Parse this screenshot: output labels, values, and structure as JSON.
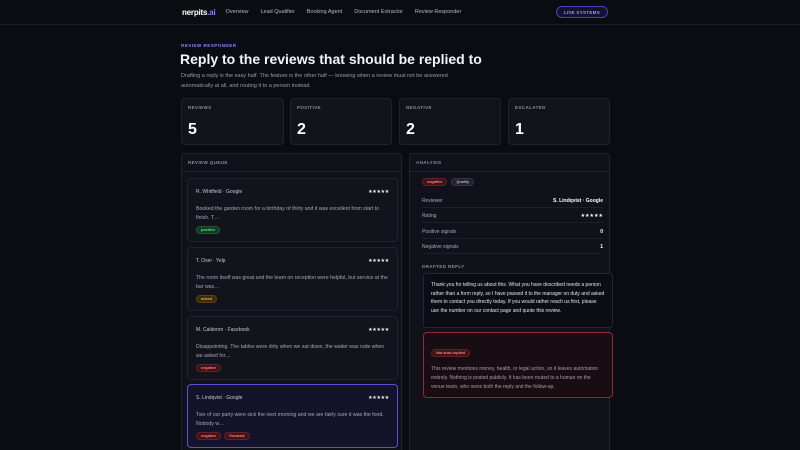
{
  "nav": {
    "brand": "nerpits",
    "brand_suffix": ".ai",
    "links": [
      "Overview",
      "Lead Qualifier",
      "Booking Agent",
      "Document Extractor",
      "Review Responder"
    ],
    "status_button": "LIVE SYSTEMS"
  },
  "header": {
    "eyebrow": "REVIEW RESPONDER",
    "title": "Reply to the reviews that should be replied to",
    "subtitle": "Drafting a reply is the easy half. The feature is the other half — knowing when a review must not be answered automatically at all, and routing it to a person instead."
  },
  "stats": [
    {
      "label": "REVIEWS",
      "value": "5"
    },
    {
      "label": "POSITIVE",
      "value": "2"
    },
    {
      "label": "NEGATIVE",
      "value": "2"
    },
    {
      "label": "ESCALATED",
      "value": "1"
    }
  ],
  "queue": {
    "title": "REVIEW QUEUE",
    "items": [
      {
        "author": "R. Whitfield · Google",
        "stars": "★★★★★",
        "text": "Booked the garden room for a birthday of thirty and it was excellent from start to finish. T…",
        "tags": [
          "positive"
        ]
      },
      {
        "author": "T. Osei · Yelp",
        "stars": "★★★★★",
        "text": "The room itself was great and the team on reception were helpful, but service at the bar was…",
        "tags": [
          "mixed"
        ]
      },
      {
        "author": "M. Calderon · Facebook",
        "stars": "★★★★★",
        "text": "Disappointing. The tables were dirty when we sat down, the waiter was rude when we asked for…",
        "tags": [
          "negative"
        ]
      },
      {
        "author": "S. Lindqvist · Google",
        "stars": "★★★★★",
        "text": "Two of our party were sick the next morning and we are fairly sure it was the food. Nobody w…",
        "tags": [
          "negative",
          "Escalate"
        ]
      }
    ]
  },
  "analysis": {
    "title": "ANALYSIS",
    "tags": [
      "negative",
      "Quality"
    ],
    "rows": [
      {
        "label": "Reviewer",
        "value": "S. Lindqvist · Google"
      },
      {
        "label": "Rating",
        "value": "★★★★★"
      },
      {
        "label": "Positive signals",
        "value": "0"
      },
      {
        "label": "Negative signals",
        "value": "1"
      }
    ],
    "draft_label": "DRAFTED REPLY",
    "draft_text": "Thank you for telling us about this. What you have described needs a person rather than a form reply, so I have passed it to the manager on duty and asked them to contact you directly today. If you would rather reach us first, please use the number on our contact page and quote this review.",
    "warning_tag": "Not auto-replied",
    "warning_text": "This review mentions money, health, or legal action, so it leaves automation entirely. Nothing is posted publicly. It has been routed to a human on the venue team, who owns both the reply and the follow-up."
  },
  "colors": {
    "accent": "#8f84ff",
    "positive": "#5fd98a",
    "mixed": "#e6b24a",
    "negative": "#ff7a82"
  }
}
